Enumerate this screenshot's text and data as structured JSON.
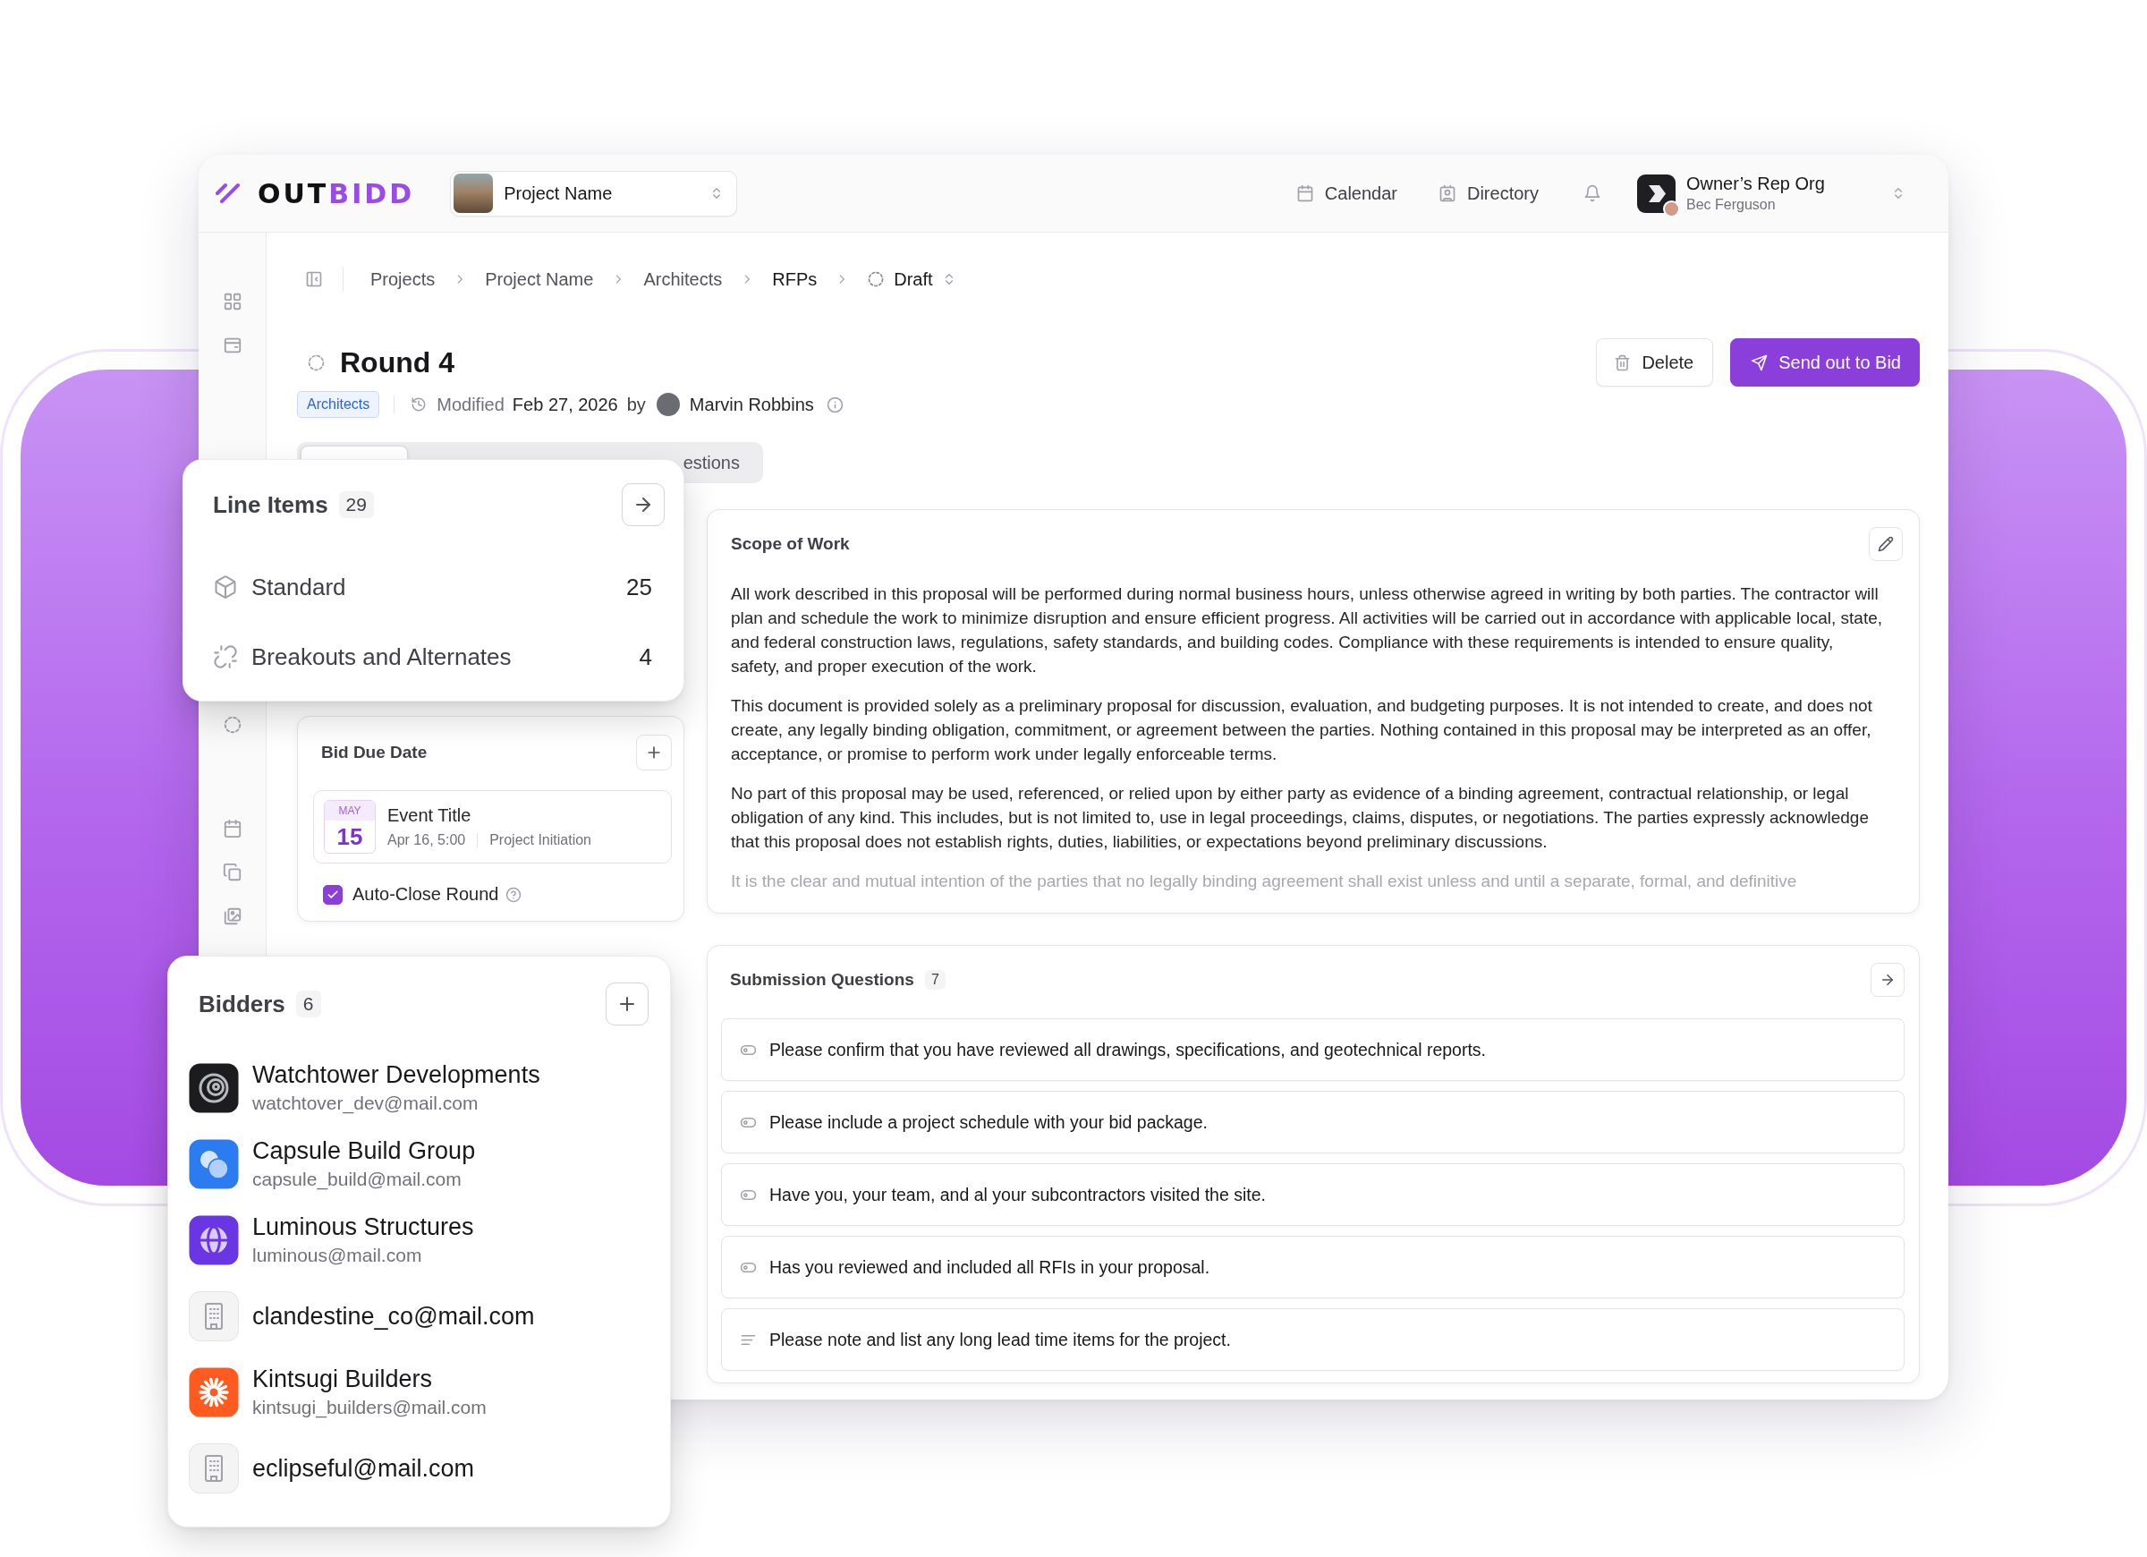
{
  "header": {
    "logo": {
      "text": "OUT",
      "accent": "BIDD"
    },
    "project_select": {
      "value": "Project Name"
    },
    "nav": [
      {
        "kind": "calendar",
        "label": "Calendar"
      },
      {
        "kind": "directory",
        "label": "Directory"
      }
    ],
    "account": {
      "org": "Owner’s Rep Org",
      "user": "Bec Ferguson"
    }
  },
  "breadcrumb": {
    "items": [
      {
        "label": "Projects",
        "current": false
      },
      {
        "label": "Project Name",
        "current": false
      },
      {
        "label": "Architects",
        "current": false
      },
      {
        "label": "RFPs",
        "current": true
      }
    ],
    "status": "Draft"
  },
  "page": {
    "title": "Round 4",
    "tag": "Architects",
    "modified_label": "Modified",
    "modified_date": "Feb 27, 2026",
    "by_label": "by",
    "author": "Marvin Robbins",
    "actions": [
      {
        "kind": "delete",
        "label": "Delete"
      },
      {
        "kind": "send",
        "label": "Send out to Bid"
      }
    ]
  },
  "tabs": [
    {
      "selected": true
    },
    {
      "label": "estions",
      "selected": false
    }
  ],
  "line_items": {
    "title": "Line Items",
    "count": "29",
    "rows": [
      {
        "kind": "standard",
        "label": "Standard",
        "count": "25"
      },
      {
        "kind": "alternate",
        "label": "Breakouts and Alternates",
        "count": "4"
      }
    ]
  },
  "bid_due_date": {
    "title": "Bid Due Date",
    "event": {
      "month": "MAY",
      "day": "15",
      "title": "Event Title",
      "time": "Apr 16, 5:00",
      "phase": "Project Initiation"
    },
    "auto_close": {
      "label": "Auto-Close Round",
      "checked": true
    }
  },
  "scope_of_work": {
    "title": "Scope of Work",
    "paragraphs": [
      {
        "text": "All work described in this proposal will be performed during normal business hours, unless otherwise agreed in writing by both parties. The contractor will plan and schedule the work to minimize disruption and ensure efficient progress. All activities will be carried out in accordance with applicable local, state, and federal construction laws, regulations, safety standards, and building codes. Compliance with these requirements is intended to ensure quality, safety, and proper execution of the work.",
        "faded": false
      },
      {
        "text": "This document is provided solely as a preliminary proposal for discussion, evaluation, and budgeting purposes. It is not intended to create, and does not create, any legally binding obligation, commitment, or agreement between the parties. Nothing contained in this proposal may be interpreted as an offer, acceptance, or promise to perform work under legally enforceable terms.",
        "faded": false
      },
      {
        "text": "No part of this proposal may be used, referenced, or relied upon by either party as evidence of a binding agreement, contractual relationship, or legal obligation of any kind. This includes, but is not limited to, use in legal proceedings, claims, disputes, or negotiations. The parties expressly acknowledge that this proposal does not establish rights, duties, liabilities, or expectations beyond preliminary discussions.",
        "faded": false
      },
      {
        "text": "It is the clear and mutual intention of the parties that no legally binding agreement shall exist unless and until a separate, formal, and definitive",
        "faded": true
      }
    ]
  },
  "submission_questions": {
    "title": "Submission Questions",
    "count": "7",
    "items": [
      {
        "kind": "yes_no",
        "text": "Please confirm that you have reviewed all drawings, specifications, and geotechnical reports."
      },
      {
        "kind": "yes_no",
        "text": "Please include a project schedule with your bid package."
      },
      {
        "kind": "yes_no",
        "text": "Have you, your team, and al your subcontractors visited the site."
      },
      {
        "kind": "yes_no",
        "text": "Has you reviewed and included all RFIs in your proposal."
      },
      {
        "kind": "text",
        "text": "Please note and list any long lead time items for the project."
      }
    ]
  },
  "bidders": {
    "title": "Bidders",
    "count": "6",
    "items": [
      {
        "kind": "spiral",
        "color": "#1c1c1f",
        "name": "Watchtower Developments",
        "email": "watchtover_dev@mail.com"
      },
      {
        "kind": "bubbles",
        "color": "#2b7cf0",
        "name": "Capsule Build Group",
        "email": "capsule_build@mail.com"
      },
      {
        "kind": "globe",
        "color": "#6a35e2",
        "name": "Luminous Structures",
        "email": "luminous@mail.com"
      },
      {
        "kind": "building",
        "color": "#f4f4f5",
        "email": "clandestine_co@mail.com"
      },
      {
        "kind": "sunburst",
        "color": "#ff5a1f",
        "name": "Kintsugi Builders",
        "email": "kintsugi_builders@mail.com"
      },
      {
        "kind": "building",
        "color": "#f4f4f5",
        "email": "eclipseful@mail.com"
      }
    ]
  }
}
